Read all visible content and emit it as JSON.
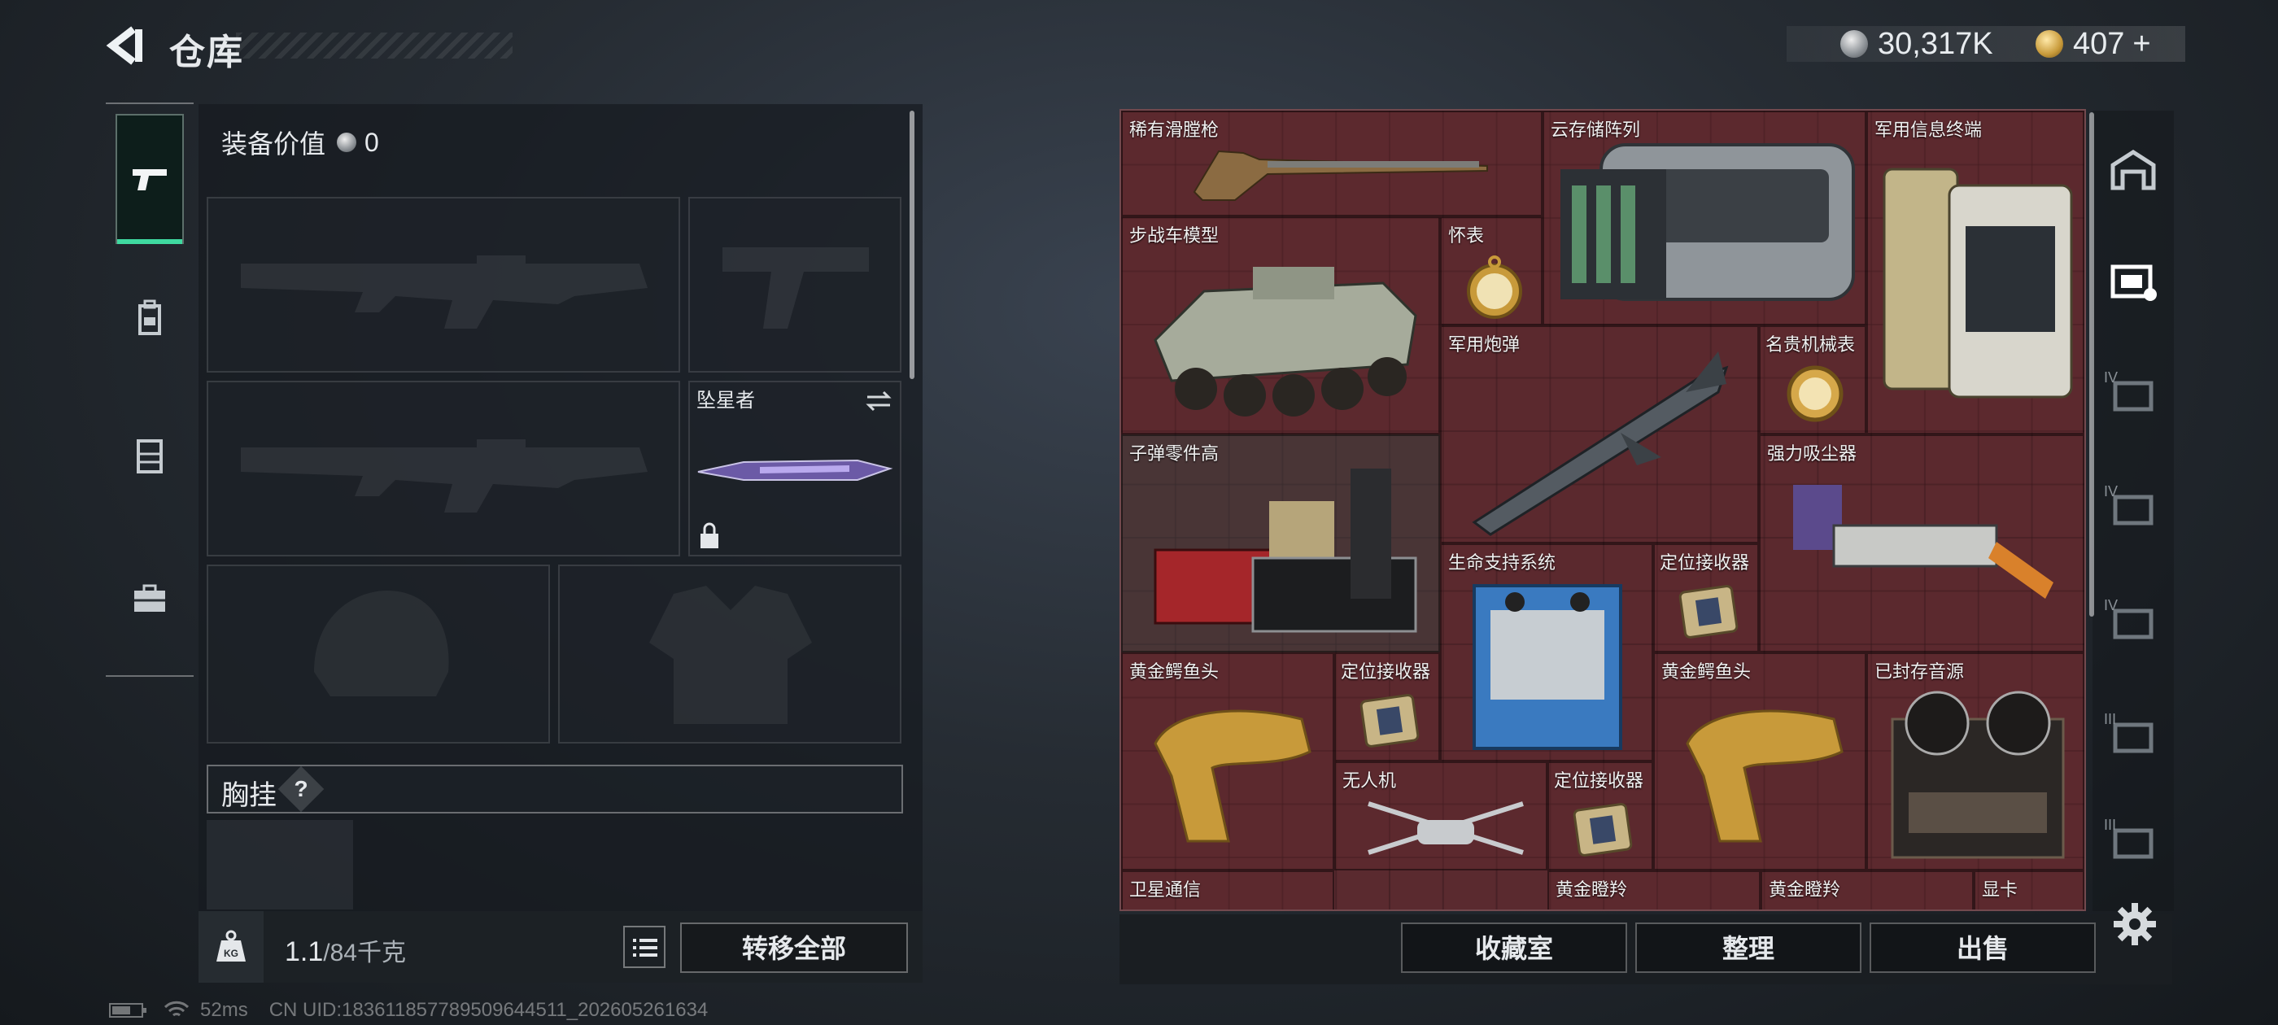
{
  "header": {
    "title": "仓库",
    "silver_amount": "30,317K",
    "gold_amount": "407",
    "gold_add": "+"
  },
  "left_panel": {
    "equip_value_label": "装备价值",
    "equip_value": "0",
    "melee_name": "坠星者",
    "chest_label": "胸挂",
    "chest_help": "?"
  },
  "bottom_left": {
    "weight_current": "1.1",
    "weight_capacity": "/84千克",
    "kg_label": "KG",
    "transfer_all": "转移全部"
  },
  "status": {
    "ping": "52ms",
    "uid": "CN UID:183611857789509644511_202605261634"
  },
  "grid_items": [
    {
      "label": "稀有滑膛枪"
    },
    {
      "label": "云存储阵列"
    },
    {
      "label": "军用信息终端"
    },
    {
      "label": "步战车模型"
    },
    {
      "label": "怀表"
    },
    {
      "label": "军用炮弹"
    },
    {
      "label": "名贵机械表"
    },
    {
      "label": "子弹零件高"
    },
    {
      "label": "强力吸尘器"
    },
    {
      "label": "生命支持系统"
    },
    {
      "label": "定位接收器"
    },
    {
      "label": "黄金鳄鱼头"
    },
    {
      "label": "定位接收器"
    },
    {
      "label": "黄金鳄鱼头"
    },
    {
      "label": "已封存音源"
    },
    {
      "label": "无人机"
    },
    {
      "label": "定位接收器"
    },
    {
      "label": "卫星通信"
    },
    {
      "label": "黄金瞪羚"
    },
    {
      "label": "黄金瞪羚"
    },
    {
      "label": "显卡"
    }
  ],
  "right_tabs": [
    "IV",
    "IV",
    "IV",
    "III",
    "III"
  ],
  "bottom_right": {
    "collection": "收藏室",
    "organize": "整理",
    "sell": "出售"
  },
  "colors": {
    "accent": "#3fd9a0",
    "grid_bg": "#5a2a2f",
    "gold": "#c89a3a"
  }
}
